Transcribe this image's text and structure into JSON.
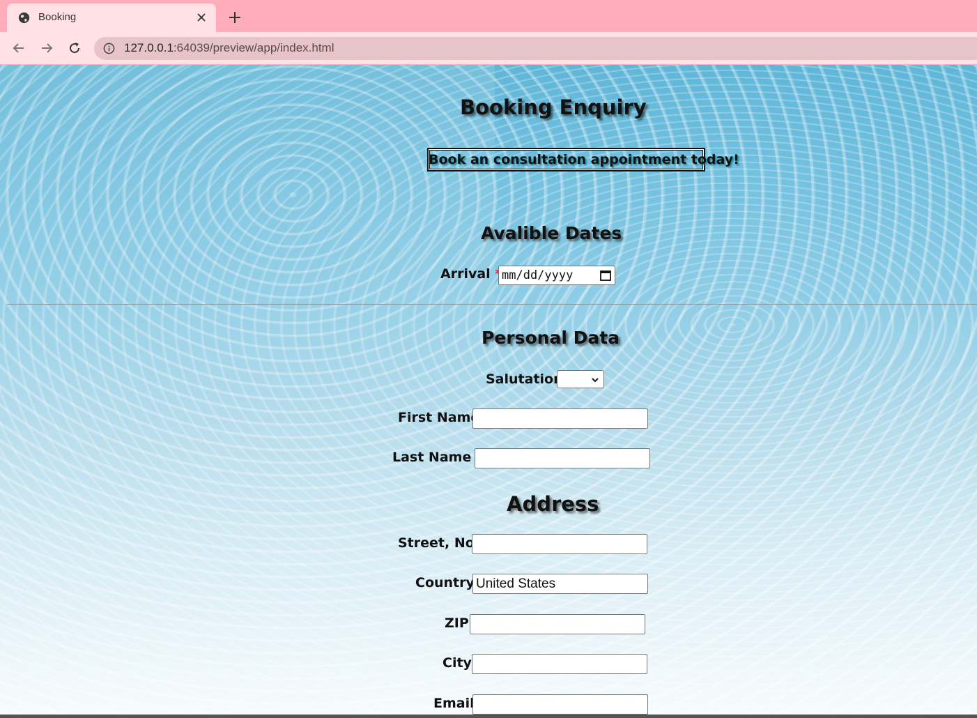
{
  "browser": {
    "tab_title": "Booking",
    "url_host": "127.0.0.1",
    "url_rest": ":64039/preview/app/index.html"
  },
  "page": {
    "title": "Booking Enquiry",
    "cta_button": "Book an consultation appointment today!",
    "dates_heading": "Avalible Dates",
    "arrival_label": "Arrival",
    "required_mark": "*",
    "arrival_placeholder": "mm/dd/yyyy",
    "personal_heading": "Personal Data",
    "salutation_label": "Salutation",
    "salutation_value": "",
    "first_name_label": "First Name",
    "first_name_value": "",
    "last_name_label": "Last Name",
    "last_name_value": "",
    "address_heading": "Address",
    "street_label": "Street, No.",
    "street_value": "",
    "country_label": "Country",
    "country_value": "United States",
    "zip_label": "ZIP",
    "zip_value": "",
    "city_label": "City",
    "city_value": "",
    "email_label": "Email",
    "email_value": ""
  },
  "colors": {
    "tabbar": "#ffadba",
    "toolbar": "#ffe1e6",
    "required": "#e02020"
  }
}
